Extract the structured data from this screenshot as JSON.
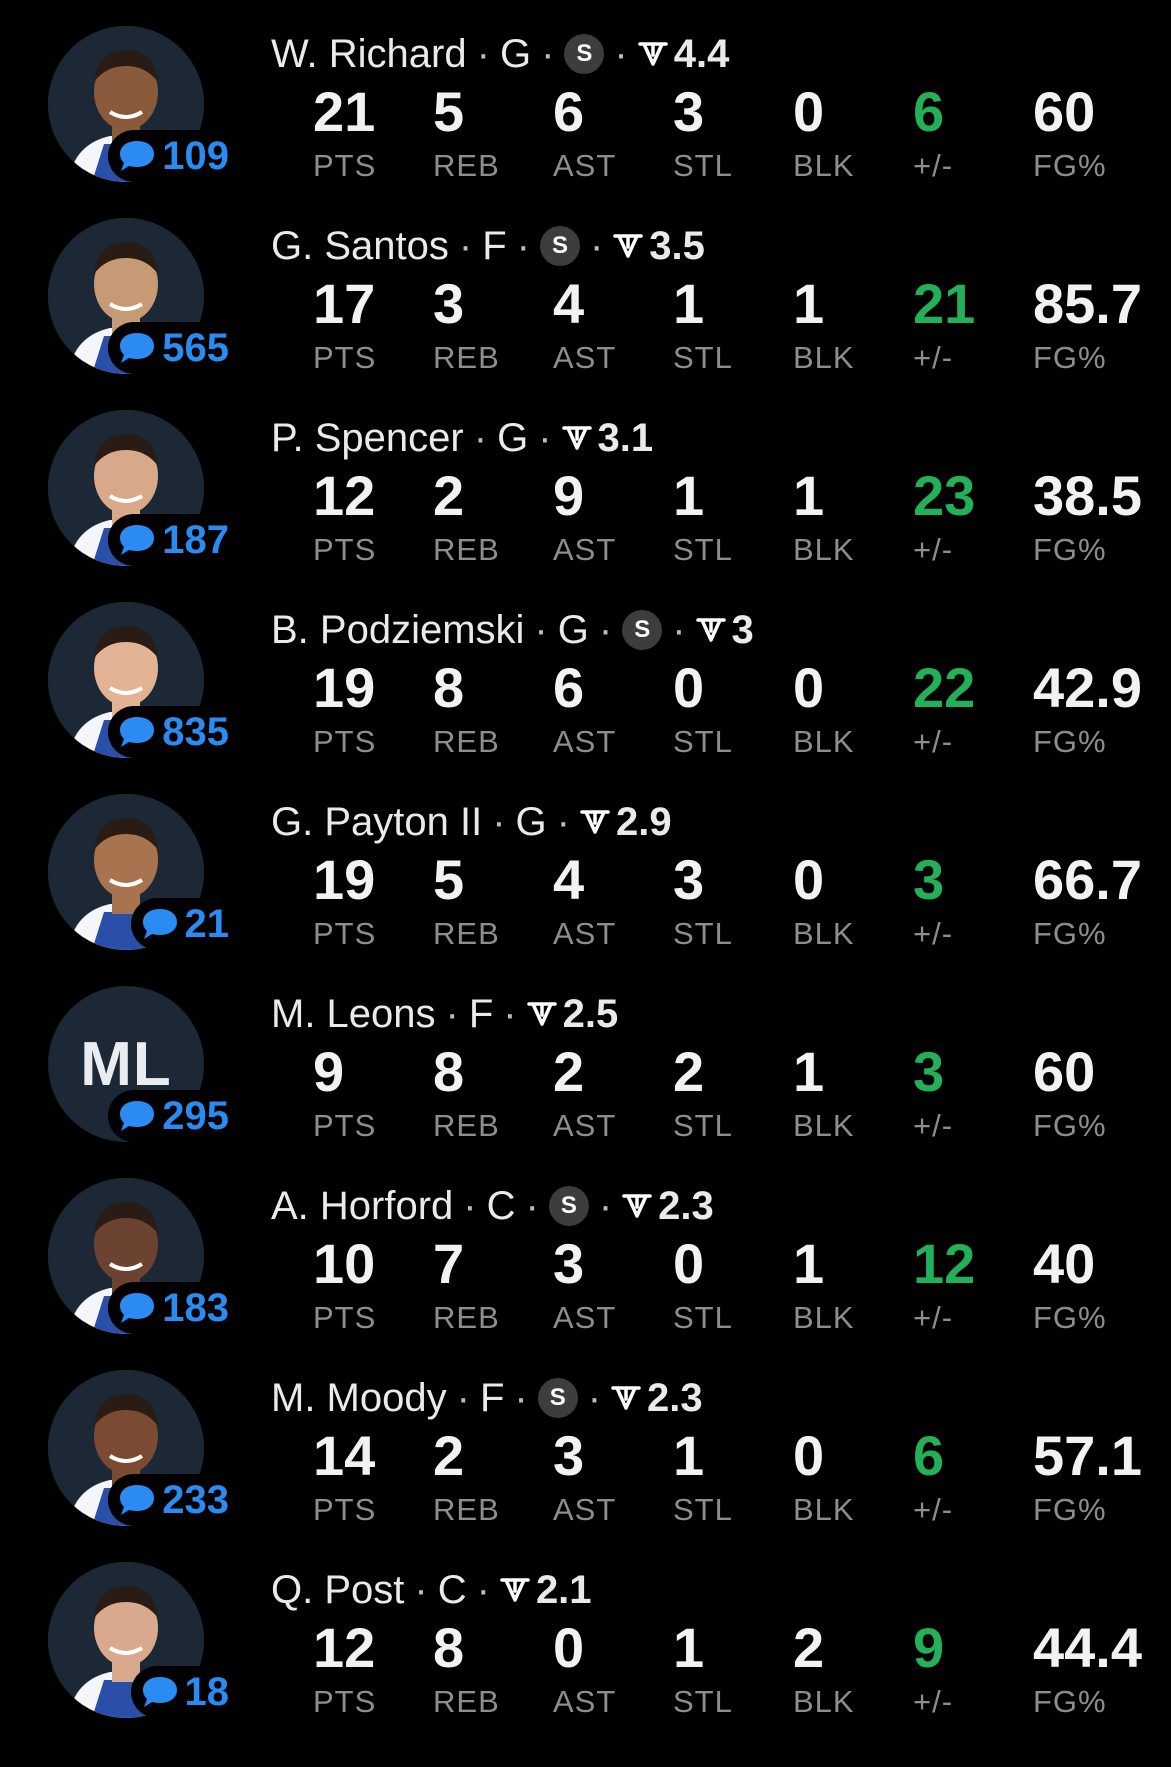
{
  "stat_labels": [
    "PTS",
    "REB",
    "AST",
    "STL",
    "BLK",
    "+/-",
    "FG%"
  ],
  "colors": {
    "background": "#000000",
    "plus_minus": "#22b05b",
    "comments": "#2a8bf2",
    "label": "#8d8d8d"
  },
  "players": [
    {
      "name": "W. Richard",
      "pos": "G",
      "starter": true,
      "rating": "4.4",
      "comments": "109",
      "avatar": "player-headshot",
      "stats": [
        "21",
        "5",
        "6",
        "3",
        "0",
        "6",
        "60"
      ]
    },
    {
      "name": "G. Santos",
      "pos": "F",
      "starter": true,
      "rating": "3.5",
      "comments": "565",
      "avatar": "player-headshot",
      "stats": [
        "17",
        "3",
        "4",
        "1",
        "1",
        "21",
        "85.7"
      ]
    },
    {
      "name": "P. Spencer",
      "pos": "G",
      "starter": false,
      "rating": "3.1",
      "comments": "187",
      "avatar": "player-headshot",
      "stats": [
        "12",
        "2",
        "9",
        "1",
        "1",
        "23",
        "38.5"
      ]
    },
    {
      "name": "B. Podziemski",
      "pos": "G",
      "starter": true,
      "rating": "3",
      "comments": "835",
      "avatar": "player-headshot",
      "stats": [
        "19",
        "8",
        "6",
        "0",
        "0",
        "22",
        "42.9"
      ]
    },
    {
      "name": "G. Payton II",
      "pos": "G",
      "starter": false,
      "rating": "2.9",
      "comments": "21",
      "avatar": "player-headshot",
      "stats": [
        "19",
        "5",
        "4",
        "3",
        "0",
        "3",
        "66.7"
      ]
    },
    {
      "name": "M. Leons",
      "pos": "F",
      "starter": false,
      "rating": "2.5",
      "comments": "295",
      "avatar": "initials",
      "initials": "ML",
      "stats": [
        "9",
        "8",
        "2",
        "2",
        "1",
        "3",
        "60"
      ]
    },
    {
      "name": "A. Horford",
      "pos": "C",
      "starter": true,
      "rating": "2.3",
      "comments": "183",
      "avatar": "player-headshot",
      "stats": [
        "10",
        "7",
        "3",
        "0",
        "1",
        "12",
        "40"
      ]
    },
    {
      "name": "M. Moody",
      "pos": "F",
      "starter": true,
      "rating": "2.3",
      "comments": "233",
      "avatar": "player-headshot",
      "stats": [
        "14",
        "2",
        "3",
        "1",
        "0",
        "6",
        "57.1"
      ]
    },
    {
      "name": "Q. Post",
      "pos": "C",
      "starter": false,
      "rating": "2.1",
      "comments": "18",
      "avatar": "player-headshot",
      "stats": [
        "12",
        "8",
        "0",
        "1",
        "2",
        "9",
        "44.4"
      ]
    }
  ],
  "starter_badge": "S"
}
